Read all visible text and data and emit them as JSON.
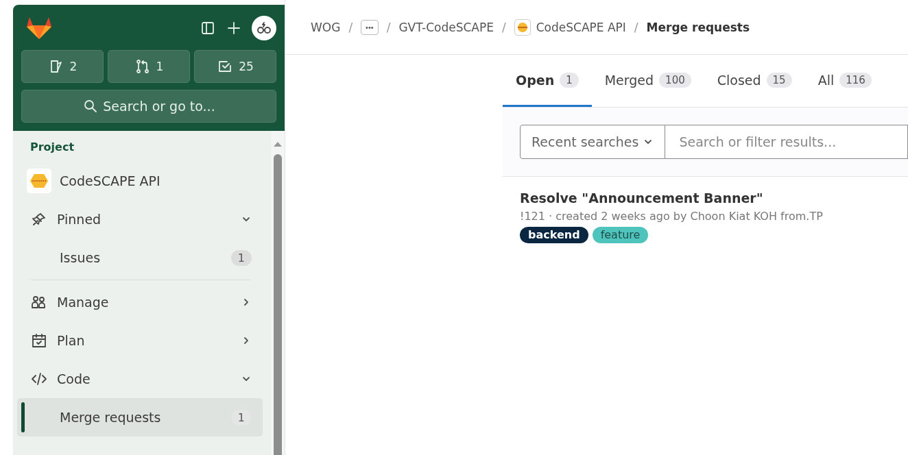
{
  "top_bar": {
    "counters": [
      {
        "kind": "issues",
        "count": "2"
      },
      {
        "kind": "merge",
        "count": "1"
      },
      {
        "kind": "todo",
        "count": "25"
      }
    ],
    "search": {
      "placeholder": "Search or go to..."
    }
  },
  "sidebar": {
    "section": "Project",
    "items": [
      {
        "kind": "project",
        "label": "CodeSCAPE API"
      },
      {
        "kind": "group",
        "label": "Pinned",
        "expanded": true
      },
      {
        "kind": "sub",
        "label": "Issues",
        "count": "1",
        "selected": false
      },
      {
        "kind": "separator"
      },
      {
        "kind": "group",
        "label": "Manage",
        "expanded": false
      },
      {
        "kind": "group",
        "label": "Plan",
        "expanded": false
      },
      {
        "kind": "group",
        "label": "Code",
        "expanded": true
      },
      {
        "kind": "sub",
        "label": "Merge requests",
        "count": "1",
        "selected": true
      }
    ]
  },
  "breadcrumb": [
    {
      "kind": "text",
      "label": "WOG"
    },
    {
      "kind": "more",
      "label": "•••",
      "separator": "/"
    },
    {
      "kind": "text",
      "label": "GVT-CodeSCAPE",
      "separator": "/"
    },
    {
      "kind": "project",
      "label": "CodeSCAPE API",
      "separator": "/"
    },
    {
      "kind": "current",
      "label": "Merge requests",
      "separator": "/"
    }
  ],
  "tabs": [
    {
      "label": "Open",
      "count": "1",
      "selected": true
    },
    {
      "label": "Merged",
      "count": "100",
      "selected": false
    },
    {
      "label": "Closed",
      "count": "15",
      "selected": false
    },
    {
      "label": "All",
      "count": "116",
      "selected": false
    }
  ],
  "filter": {
    "recent": "Recent searches",
    "placeholder": "Search or filter results..."
  },
  "merge_requests": [
    {
      "title": "Resolve \"Announcement Banner\"",
      "meta": "!121 · created 2 weeks ago by Choon Kiat KOH from.TP",
      "labels": [
        {
          "name": "backend",
          "color": "#0b2640"
        },
        {
          "name": "feature",
          "color": "#4fc4bd"
        }
      ]
    }
  ]
}
